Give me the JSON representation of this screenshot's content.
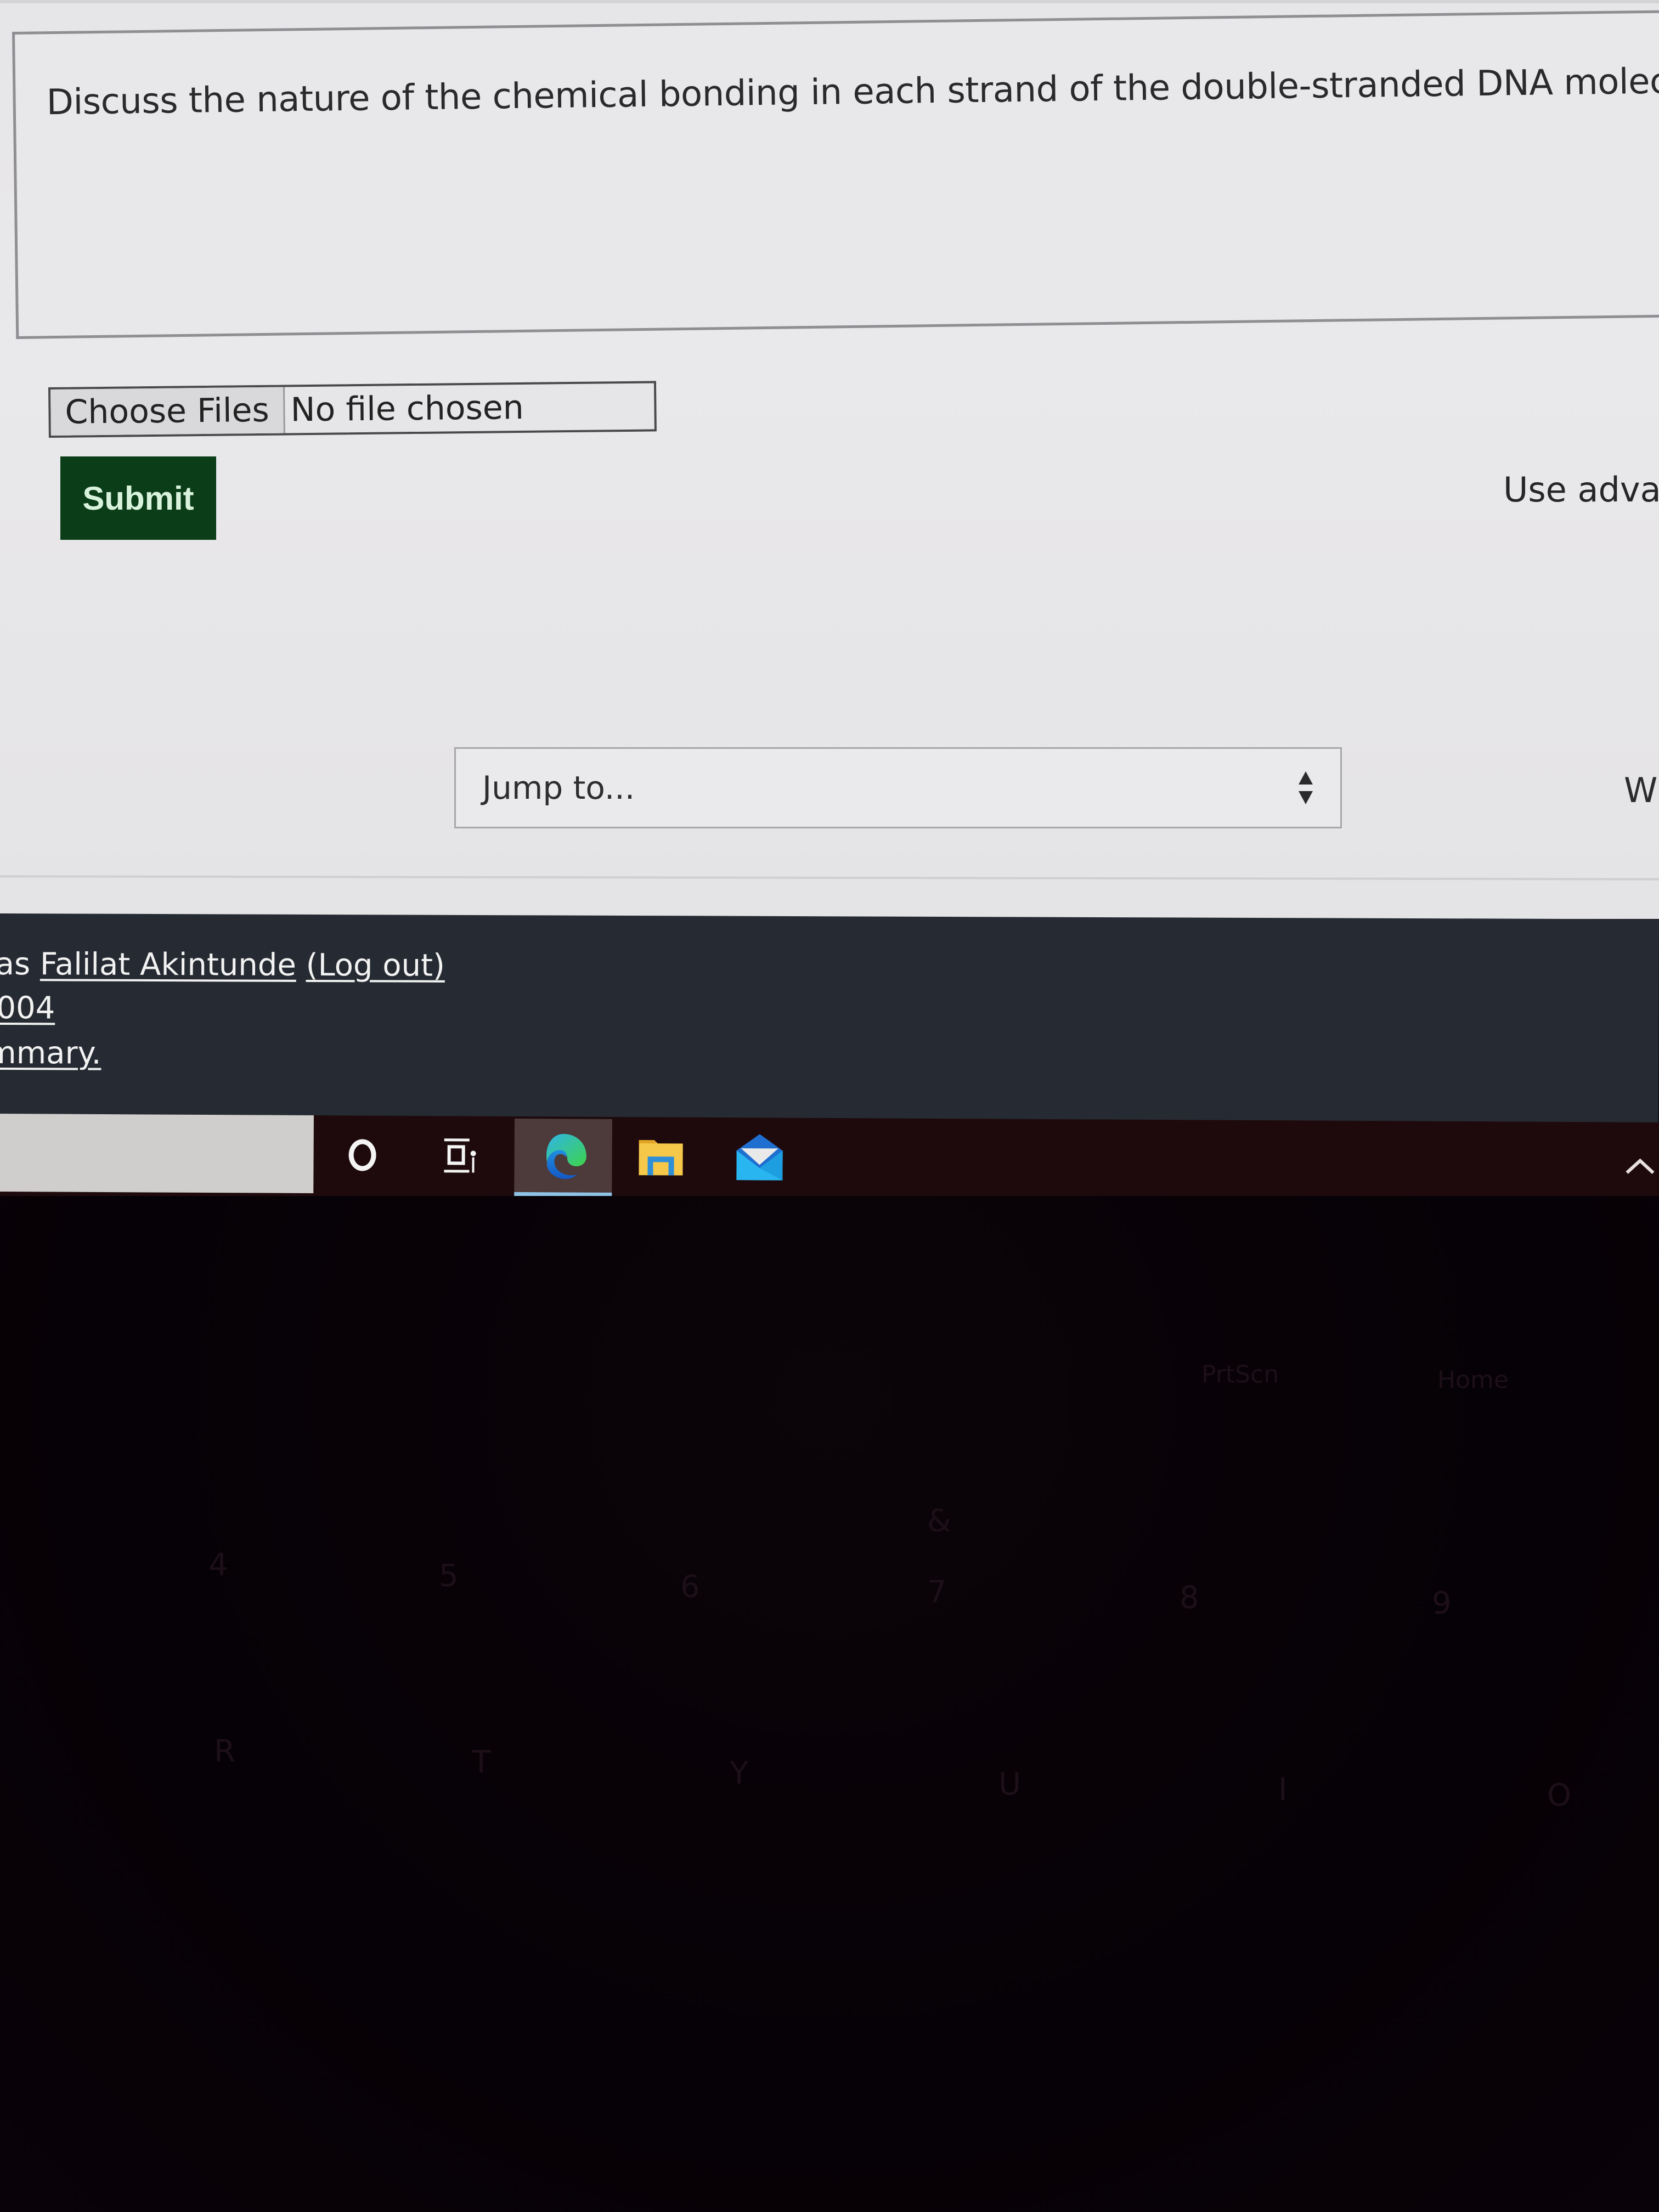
{
  "question": {
    "prompt": "Discuss the nature of the chemical bonding in each strand of the double-stranded DNA molecule."
  },
  "file_upload": {
    "button_label": "Choose Files",
    "status": "No file chosen"
  },
  "actions": {
    "submit_label": "Submit",
    "advanced_upload_label": "Use advan"
  },
  "navigation": {
    "jump_to_placeholder": "Jump to...",
    "next_activity_partial": "W"
  },
  "footer": {
    "logged_in_prefix": "as",
    "user_name": "Falilat Akintunde",
    "logout_label": "(Log out)",
    "course_code": "004",
    "summary_link": "mmary."
  },
  "taskbar": {
    "items": [
      {
        "name": "cortana",
        "icon": "cortana-circle-icon"
      },
      {
        "name": "task-view",
        "icon": "task-view-icon"
      },
      {
        "name": "microsoft-edge",
        "icon": "edge-icon",
        "active": true
      },
      {
        "name": "file-explorer",
        "icon": "folder-icon"
      },
      {
        "name": "mail",
        "icon": "mail-icon"
      }
    ],
    "tray_icon": "chevron-up-icon",
    "active_indicator_color": "#8fc3e6"
  },
  "keyboard": {
    "keys": [
      "PrtScn",
      "Home",
      "4",
      "5",
      "6",
      "7",
      "8",
      "9",
      "&",
      "R",
      "T",
      "Y",
      "U",
      "I",
      "O"
    ]
  },
  "colors": {
    "submit_bg": "#0a3d18",
    "submit_text": "#d9f2dc",
    "footer_bg": "#262b33",
    "page_bg": "#e8e7e9",
    "taskbar_bg": "#1e0a0c"
  }
}
